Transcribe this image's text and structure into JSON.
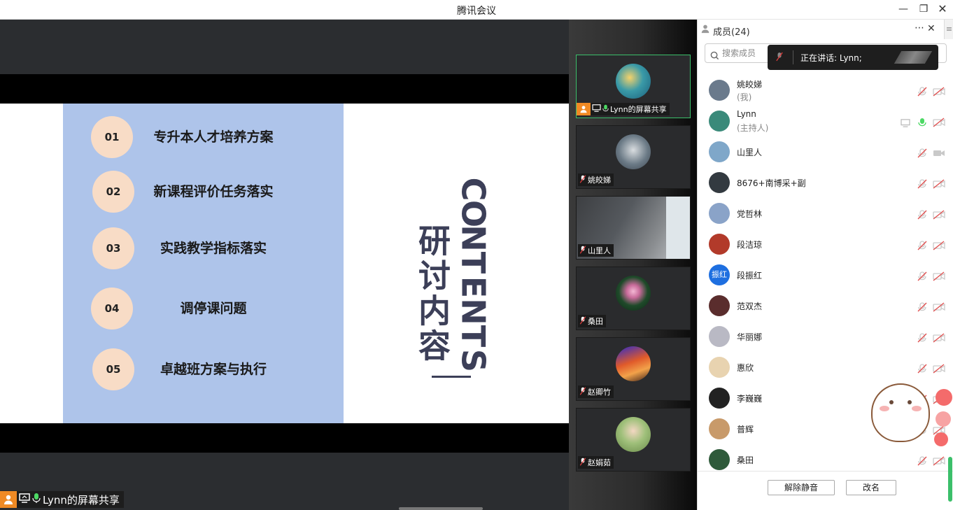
{
  "window": {
    "title": "腾讯会议"
  },
  "slide": {
    "items": [
      {
        "num": "01",
        "text": "专升本人才培养方案"
      },
      {
        "num": "02",
        "text": "新课程评价任务落实"
      },
      {
        "num": "03",
        "text": "实践教学指标落实"
      },
      {
        "num": "04",
        "text": "调停课问题"
      },
      {
        "num": "05",
        "text": "卓越班方案与执行"
      }
    ],
    "cn_title": "研讨内容",
    "en_letters": [
      "C",
      "O",
      "N",
      "T",
      "E",
      "N",
      "T",
      "S"
    ]
  },
  "share_label": "Lynn的屏幕共享",
  "tiles": [
    {
      "name": "Lynn的屏幕共享"
    },
    {
      "name": "姚皎娣"
    },
    {
      "name": "山里人"
    },
    {
      "name": "桑田"
    },
    {
      "name": "赵卿竹"
    },
    {
      "name": "赵娟茹"
    }
  ],
  "panel": {
    "title": "成员(24)",
    "search_placeholder": "搜索成员",
    "toast": "正在讲话: Lynn;",
    "members": [
      {
        "name": "姚皎娣",
        "role": "(我)",
        "color": "#6a7a8c"
      },
      {
        "name": "Lynn",
        "role": "(主持人)",
        "color": "#3a8a7a",
        "speaking": true
      },
      {
        "name": "山里人",
        "role": "",
        "color": "#7fa7c9"
      },
      {
        "name": "8676+南博采+副",
        "role": "",
        "color": "#333a40"
      },
      {
        "name": "党哲林",
        "role": "",
        "color": "#8aa3c8"
      },
      {
        "name": "段洁琼",
        "role": "",
        "color": "#b23a2a"
      },
      {
        "name": "段振红",
        "role": "",
        "color": "#1e6fe0",
        "initials": "振红"
      },
      {
        "name": "范双杰",
        "role": "",
        "color": "#5a2d2d"
      },
      {
        "name": "华丽娜",
        "role": "",
        "color": "#b9b9c4"
      },
      {
        "name": "惠欣",
        "role": "",
        "color": "#e8d3b0"
      },
      {
        "name": "李巍巍",
        "role": "",
        "color": "#222222"
      },
      {
        "name": "普辉",
        "role": "",
        "color": "#c89a6a"
      },
      {
        "name": "桑田",
        "role": "",
        "color": "#2e5a3a"
      }
    ],
    "unmute_label": "解除静音",
    "rename_label": "改名"
  }
}
